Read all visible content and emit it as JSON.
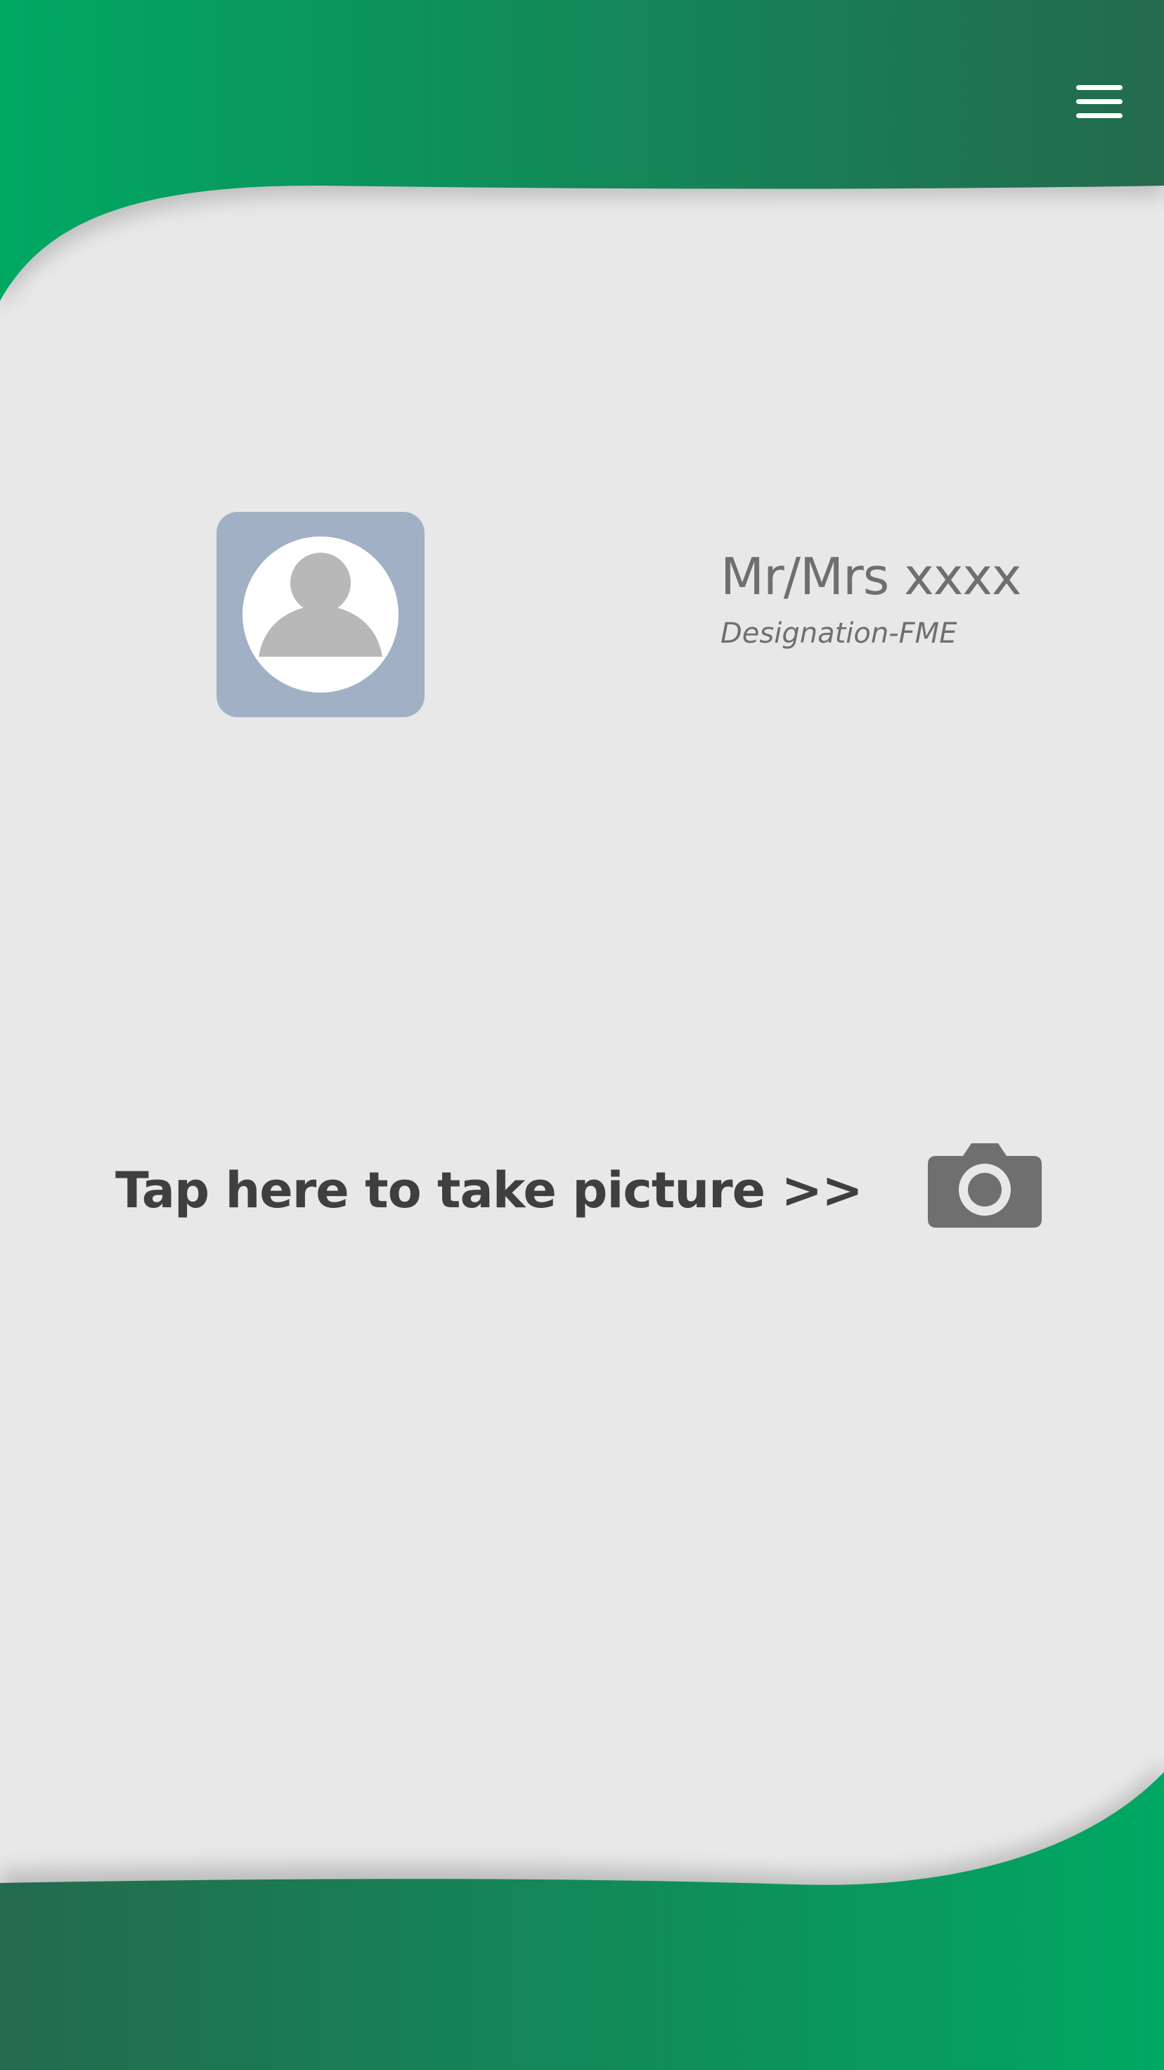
{
  "header": {
    "menu_icon": "hamburger-menu-icon",
    "gradient_start": "#00a862",
    "gradient_end": "#246a4e"
  },
  "profile": {
    "avatar_icon": "user-avatar-icon",
    "name": "Mr/Mrs xxxx",
    "designation": "Designation-FME"
  },
  "action": {
    "label": "Tap here to take picture >>",
    "icon": "camera-icon"
  },
  "footer": {
    "gradient_start": "#246a4e",
    "gradient_end": "#00a862"
  },
  "colors": {
    "background": "#e8e8e9",
    "avatar_tile": "#a1b0c5",
    "text_primary": "#3f3f3f",
    "text_secondary": "#6f6f6f"
  }
}
